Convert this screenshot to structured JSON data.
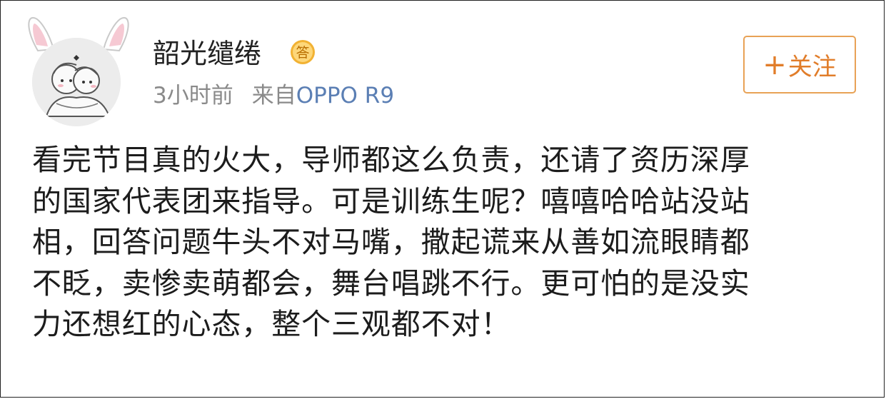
{
  "post": {
    "username": "韶光缱绻",
    "badge_text": "答",
    "time": "3小时前",
    "source_prefix": "来自",
    "device": "OPPO R9",
    "follow_label": "关注",
    "content_lines": [
      "看完节目真的火大，导师都这么负责，还请了资历深厚",
      "的国家代表团来指导。可是训练生呢？嘻嘻哈哈站没站",
      "相，回答问题牛头不对马嘴，撒起谎来从善如流眼睛都",
      "不眨，卖惨卖萌都会，舞台唱跳不行。更可怕的是没实",
      "力还想红的心态，整个三观都不对！"
    ]
  },
  "colors": {
    "accent": "#e17d2a",
    "link": "#5b7fb4",
    "muted": "#8a8a8a",
    "badge": "#f2b233"
  }
}
